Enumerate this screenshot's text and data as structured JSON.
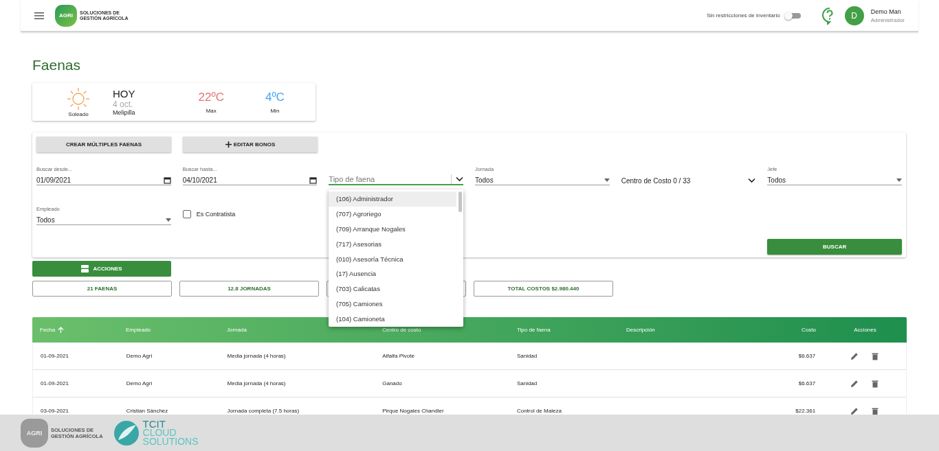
{
  "header": {
    "logo": {
      "mark": "AGRI",
      "lines": [
        "SOLUCIONES DE",
        "GESTIÓN AGRÍCOLA"
      ]
    },
    "inventory_toggle": {
      "label": "Sin restricciones de inventario",
      "on": false
    },
    "user": {
      "initial": "D",
      "name": "Demo Man",
      "role": "Administrador"
    }
  },
  "page_title": "Faenas",
  "weather": {
    "condition": "Soleado",
    "day": "HOY",
    "date": "4 oct.",
    "place": "Melipilla",
    "max": {
      "value": "22ºC",
      "label": "Max"
    },
    "min": {
      "value": "4ºC",
      "label": "Min"
    }
  },
  "filters": {
    "buttons": [
      {
        "label": "CREAR MÚLTIPLES FAENAS",
        "kind": "plain"
      },
      {
        "label": "EDITAR BONOS",
        "kind": "add"
      }
    ],
    "fields": [
      {
        "kind": "date",
        "label": "Buscar desde...",
        "value": "01/09/2021"
      },
      {
        "kind": "date",
        "label": "Buscar hasta...",
        "value": "04/10/2021"
      },
      {
        "kind": "combo",
        "placeholder": "Tipo de faena",
        "focused": true
      },
      {
        "kind": "select",
        "label": "Jornada",
        "value": "Todos"
      },
      {
        "kind": "multi",
        "value": "Centro de Costo 0 / 33"
      },
      {
        "kind": "select",
        "label": "Jefe",
        "value": "Todos"
      },
      {
        "kind": "select",
        "label": "Empleado",
        "value": "Todos"
      },
      {
        "kind": "checkbox",
        "label": "Es Contratista",
        "checked": false
      }
    ],
    "search_button": "BUSCAR"
  },
  "dropdown": {
    "options": [
      {
        "label": "(106) Administrador",
        "selected": true
      },
      {
        "label": "(707) Agroriego",
        "selected": false
      },
      {
        "label": "(709) Arranque Nogales",
        "selected": false
      },
      {
        "label": "(717) Asesorias",
        "selected": false
      },
      {
        "label": "(010) Asesoría Técnica",
        "selected": false
      },
      {
        "label": "(17) Ausencia",
        "selected": false
      },
      {
        "label": "(703) Calicatas",
        "selected": false
      },
      {
        "label": "(705) Camiones",
        "selected": false
      },
      {
        "label": "(104) Camioneta",
        "selected": false
      }
    ]
  },
  "actions_button": "ACCIONES",
  "summary": [
    {
      "label": "21 FAENAS"
    },
    {
      "label": "12.8 JORNADAS"
    },
    {
      "kind": "covered"
    },
    {
      "label": "TOTAL COSTOS $2.980.440"
    }
  ],
  "table": {
    "columns": [
      {
        "label": "Fecha",
        "sorted": true
      },
      {
        "label": "Empleado"
      },
      {
        "label": "Jornada"
      },
      {
        "label": "Centro de costo"
      },
      {
        "label": "Tipo de faena"
      },
      {
        "label": "Descripción"
      },
      {
        "label": "Costo"
      },
      {
        "label": "Acciones"
      }
    ],
    "rows": [
      [
        "01-09-2021",
        "Demo Agri",
        "Media jornada (4 horas)",
        "Alfalfa Pivote",
        "Sanidad",
        "",
        "$6.637"
      ],
      [
        "01-09-2021",
        "Demo Agri",
        "Media jornada (4 horas)",
        "Ganado",
        "Sanidad",
        "",
        "$6.637"
      ],
      [
        "03-09-2021",
        "Cristian Sánchez",
        "Jornada completa (7.5 horas)",
        "Pirque Nogales Chandler",
        "Control de Maleza",
        "",
        "$22.361"
      ]
    ]
  },
  "footer": {
    "agri": {
      "mark": "AGRI",
      "lines": [
        "SOLUCIONES DE",
        "GESTIÓN AGRÍCOLA"
      ]
    },
    "tcit": {
      "name": "TCIT",
      "lines": [
        "CLOUD",
        "SOLUTIONS"
      ]
    }
  }
}
